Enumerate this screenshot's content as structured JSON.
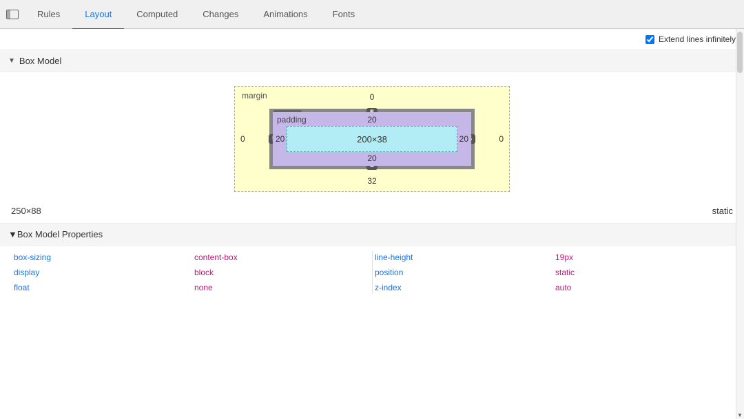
{
  "tabs": [
    {
      "id": "rules",
      "label": "Rules",
      "active": false
    },
    {
      "id": "layout",
      "label": "Layout",
      "active": true
    },
    {
      "id": "computed",
      "label": "Computed",
      "active": false
    },
    {
      "id": "changes",
      "label": "Changes",
      "active": false
    },
    {
      "id": "animations",
      "label": "Animations",
      "active": false
    },
    {
      "id": "fonts",
      "label": "Fonts",
      "active": false
    }
  ],
  "extend_lines": {
    "label": "Extend lines infinitely",
    "checked": true
  },
  "box_model": {
    "section_label": "Box Model",
    "margin": {
      "label": "margin",
      "top": "0",
      "right": "0",
      "bottom": "32",
      "left": "0"
    },
    "border": {
      "label": "border",
      "top": "5",
      "right": "5",
      "bottom": "5",
      "left": "5"
    },
    "padding": {
      "label": "padding",
      "top": "20",
      "right": "20",
      "bottom": "20",
      "left": "20"
    },
    "content": {
      "width": "200",
      "height": "38",
      "label": "200×38"
    }
  },
  "dimension": {
    "value": "250×88",
    "position": "static"
  },
  "box_model_properties": {
    "section_label": "Box Model Properties",
    "left_column": [
      {
        "name": "box-sizing",
        "value": "content-box"
      },
      {
        "name": "display",
        "value": "block"
      },
      {
        "name": "float",
        "value": "none"
      }
    ],
    "right_column": [
      {
        "name": "line-height",
        "value": "19px"
      },
      {
        "name": "position",
        "value": "static"
      },
      {
        "name": "z-index",
        "value": "auto"
      }
    ]
  }
}
